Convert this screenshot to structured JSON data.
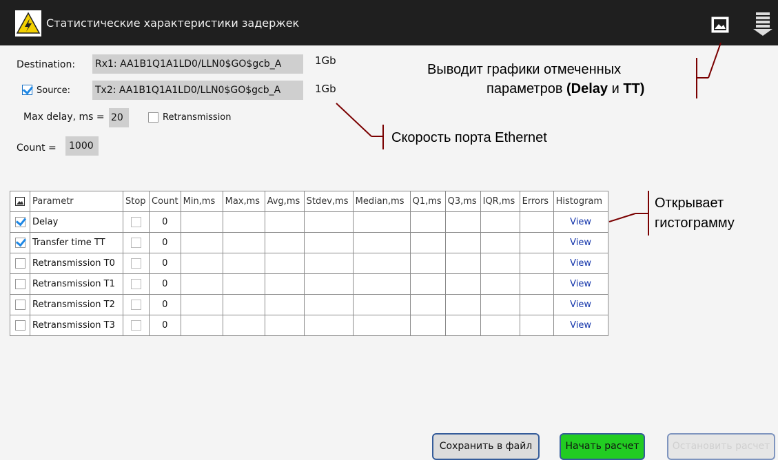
{
  "header": {
    "title": "Статистические характеристики задержек"
  },
  "form": {
    "destination_label": "Destination:",
    "destination_value": "Rx1: AA1B1Q1A1LD0/LLN0$GO$gcb_A",
    "destination_speed": "1Gb",
    "source_label": "Source:",
    "source_checked": true,
    "source_value": "Tx2: AA1B1Q1A1LD0/LLN0$GO$gcb_A",
    "source_speed": "1Gb",
    "max_delay_label": "Max delay, ms =",
    "max_delay_value": "20",
    "retransmission_label": "Retransmission",
    "retransmission_checked": false,
    "count_label": "Count =",
    "count_value": "1000"
  },
  "annotations": {
    "graphs_line1": "Выводит графики отмеченных",
    "graphs_line2_prefix": "параметров ",
    "graphs_delay": "(Delay",
    "graphs_and": " и ",
    "graphs_tt": "TT)",
    "speed": "Скорость порта Ethernet",
    "histogram_line1": "Открывает",
    "histogram_line2": "гистограмму"
  },
  "table": {
    "headers": [
      "",
      "Parametr",
      "Stop",
      "Count",
      "Min,ms",
      "Max,ms",
      "Avg,ms",
      "Stdev,ms",
      "Median,ms",
      "Q1,ms",
      "Q3,ms",
      "IQR,ms",
      "Errors",
      "Histogram"
    ],
    "rows": [
      {
        "checked": true,
        "param": "Delay",
        "count": "0",
        "view": "View"
      },
      {
        "checked": true,
        "param": "Transfer time TT",
        "count": "0",
        "view": "View"
      },
      {
        "checked": false,
        "param": "Retransmission T0",
        "count": "0",
        "view": "View"
      },
      {
        "checked": false,
        "param": "Retransmission T1",
        "count": "0",
        "view": "View"
      },
      {
        "checked": false,
        "param": "Retransmission T2",
        "count": "0",
        "view": "View"
      },
      {
        "checked": false,
        "param": "Retransmission T3",
        "count": "0",
        "view": "View"
      }
    ]
  },
  "buttons": {
    "save": "Сохранить в файл",
    "start": "Начать расчет",
    "stop": "Остановить расчет"
  },
  "colors": {
    "titlebar": "#1f1f1f",
    "annotation_line": "#7a0000",
    "start_button": "#22cc22",
    "button_border": "#355c9a"
  },
  "icons": [
    "warning-icon",
    "image-icon",
    "menu-icon"
  ]
}
